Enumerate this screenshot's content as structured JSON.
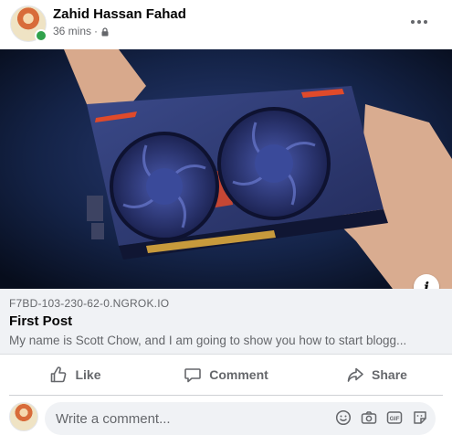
{
  "post": {
    "author": "Zahid Hassan Fahad",
    "time": "36 mins",
    "separator": "·",
    "privacy_icon": "lock-icon",
    "more_icon": "more-horizontal-icon"
  },
  "media": {
    "info_label": "i"
  },
  "link_preview": {
    "domain": "F7BD-103-230-62-0.NGROK.IO",
    "title": "First Post",
    "description": "My name is Scott Chow, and I am going to show you how to start blogg..."
  },
  "actions": {
    "like": "Like",
    "comment": "Comment",
    "share": "Share"
  },
  "comment_box": {
    "placeholder": "Write a comment...",
    "icons": [
      "smiley-icon",
      "camera-icon",
      "gif-icon",
      "sticker-icon"
    ]
  },
  "colors": {
    "muted_text": "#65676b",
    "preview_bg": "#f0f2f5",
    "online": "#31a24c"
  }
}
